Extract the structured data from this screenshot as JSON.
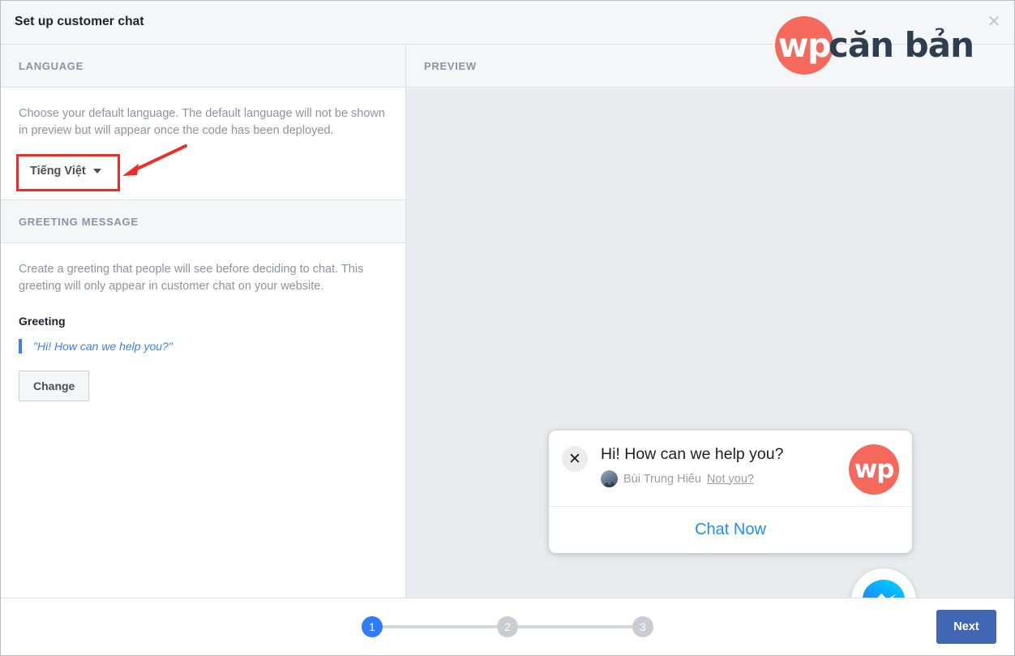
{
  "dialog": {
    "title": "Set up customer chat",
    "close_icon": "close-icon"
  },
  "brand": {
    "mark": "wp",
    "word": "căn bản"
  },
  "left_panel": {
    "language_section": {
      "header": "LANGUAGE",
      "description": "Choose your default language. The default language will not be shown in preview but will appear once the code has been deployed.",
      "dropdown_value": "Tiếng Việt",
      "caret_icon": "chevron-down-icon"
    },
    "greeting_section": {
      "header": "GREETING MESSAGE",
      "description": "Create a greeting that people will see before deciding to chat. This greeting will only appear in customer chat on your website.",
      "field_label": "Greeting",
      "quote": "\"Hi! How can we help you?\"",
      "change_label": "Change"
    }
  },
  "preview_panel": {
    "header": "PREVIEW",
    "chat_card": {
      "close_icon": "close-icon",
      "greeting": "Hi! How can we help you?",
      "username": "Bùi Trung Hiếu",
      "not_you_label": "Not you?",
      "logo_mark": "wp",
      "action_label": "Chat Now"
    },
    "messenger_fab_icon": "messenger-icon"
  },
  "footer": {
    "steps": [
      {
        "number": "1",
        "state": "active"
      },
      {
        "number": "2",
        "state": "inactive"
      },
      {
        "number": "3",
        "state": "inactive"
      }
    ],
    "next_label": "Next"
  },
  "colors": {
    "brand_coral": "#f4695c",
    "brand_navy": "#2c3e50",
    "accent_blue": "#1f8dfb",
    "fb_blue": "#4267b2",
    "step_active": "#2e7cf6",
    "annotation_red": "#ee2b24",
    "quote_blue": "#3b7ef5",
    "preview_bg": "#e9ebee",
    "panel_bg": "#f5f6f7"
  }
}
